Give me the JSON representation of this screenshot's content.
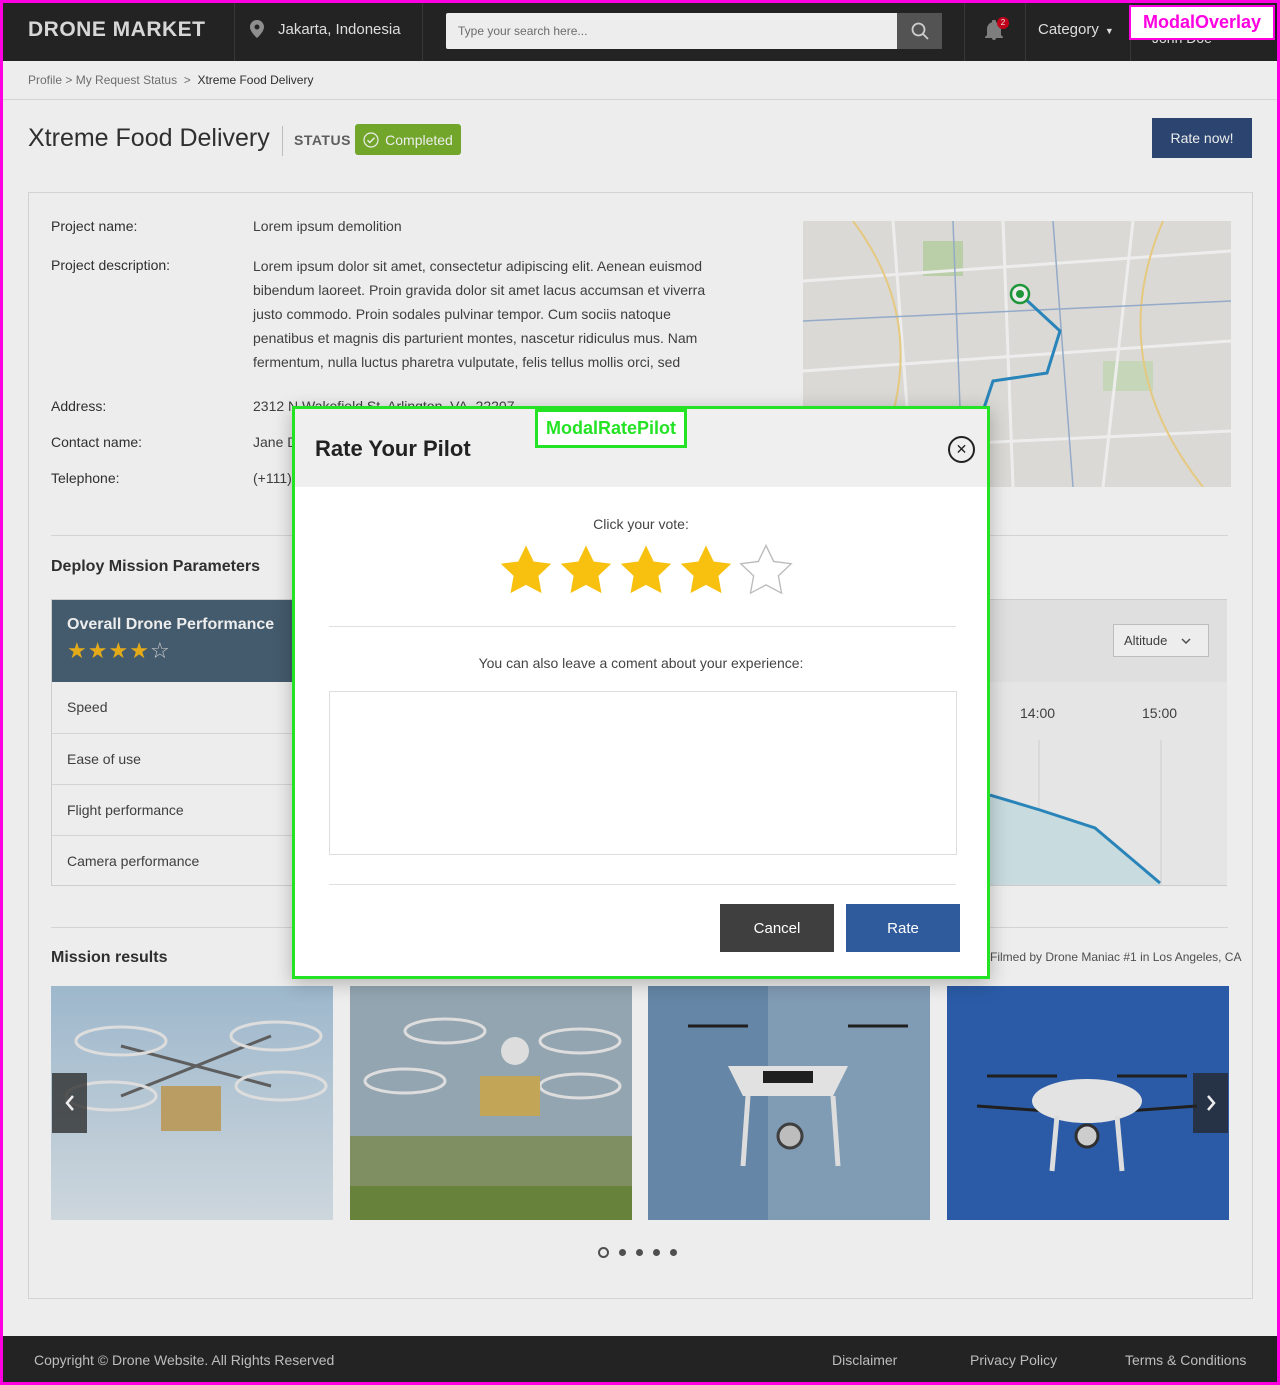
{
  "header": {
    "logo": "DRONE MARKET",
    "location": "Jakarta, Indonesia",
    "search_placeholder": "Type your search here...",
    "notification_count": "2",
    "category_label": "Category",
    "user_name": "John Doe"
  },
  "breadcrumb": {
    "items": [
      "Profile",
      "My Request Status"
    ],
    "current": "Xtreme Food Delivery"
  },
  "title_row": {
    "title": "Xtreme Food Delivery",
    "status_label": "STATUS",
    "status_value": "Completed",
    "rate_now_label": "Rate now!"
  },
  "project": {
    "name_label": "Project name:",
    "name_value": "Lorem ipsum demolition",
    "description_label": "Project description:",
    "description_lines": [
      "Lorem ipsum dolor sit amet, consectetur adipiscing elit. Aenean euismod",
      "bibendum laoreet. Proin gravida dolor sit amet lacus accumsan et viverra",
      "justo commodo. Proin sodales pulvinar tempor. Cum sociis natoque",
      "penatibus et magnis dis parturient montes, nascetur ridiculus mus. Nam",
      "fermentum, nulla luctus pharetra vulputate, felis tellus mollis orci, sed"
    ],
    "address_label": "Address:",
    "address_value": "2312 N Wakefield St, Arlington, VA, 22207",
    "contact_label": "Contact name:",
    "contact_value": "Jane D",
    "telephone_label": "Telephone:",
    "telephone_value": "(+111)"
  },
  "mission_params": {
    "section_title": "Deploy Mission Parameters",
    "perf_title": "Overall Drone Performance",
    "perf_rating": 4,
    "perf_max": 5,
    "rows": [
      "Speed",
      "Ease of use",
      "Flight performance",
      "Camera performance"
    ],
    "dropdown_value": "Altitude",
    "time_labels": [
      "14:00",
      "15:00"
    ]
  },
  "mission_results": {
    "section_title": "Mission results",
    "credit": "Filmed by Drone Maniac #1 in Los Angeles, CA",
    "slide_count": 5,
    "active_slide": 1
  },
  "footer": {
    "copyright": "Copyright © Drone Website. All Rights Reserved",
    "links": [
      "Disclaimer",
      "Privacy Policy",
      "Terms & Conditions"
    ]
  },
  "overlay": {
    "tag": "ModalOverlay"
  },
  "modal": {
    "tag": "ModalRatePilot",
    "title": "Rate Your Pilot",
    "vote_label": "Click your vote:",
    "rating": 4,
    "max_rating": 5,
    "comment_label": "You can also leave a coment about your experience:",
    "comment_value": "",
    "cancel_label": "Cancel",
    "rate_label": "Rate"
  },
  "colors": {
    "header_bg": "#262626",
    "accent_blue": "#2f4b79",
    "status_green": "#7ab32e",
    "star_gold": "#f5b71b",
    "overlay_outline": "#ff00e1",
    "modal_outline": "#24e324"
  }
}
